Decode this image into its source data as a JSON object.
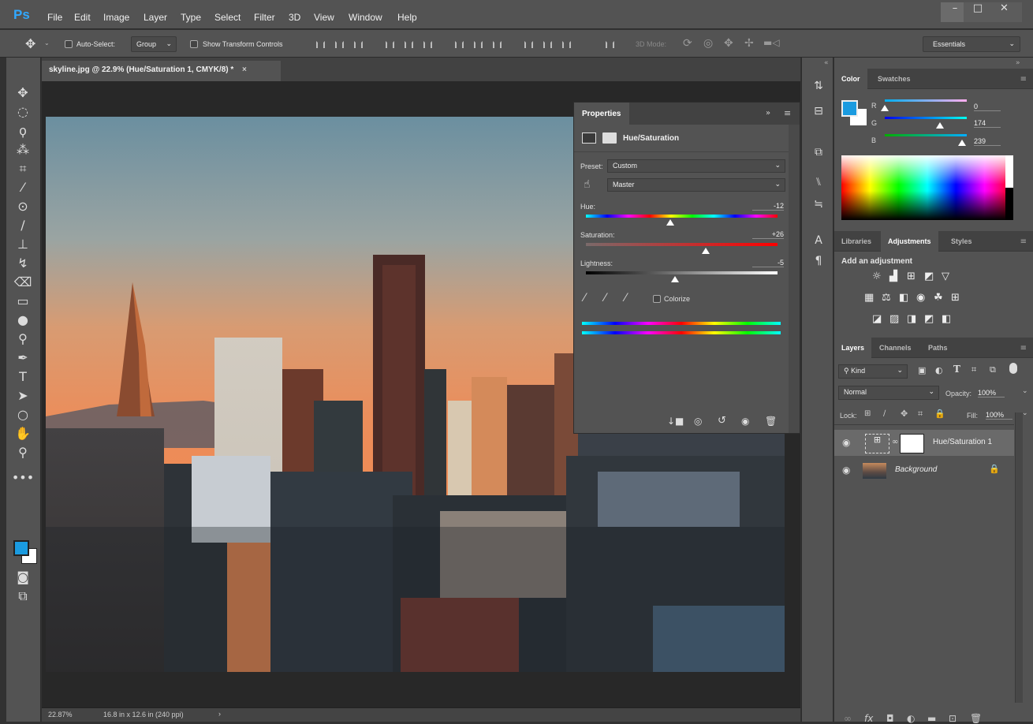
{
  "app": {
    "logo": "Ps",
    "brand_color": "#31a8ff"
  },
  "menu": [
    "File",
    "Edit",
    "Image",
    "Layer",
    "Type",
    "Select",
    "Filter",
    "3D",
    "View",
    "Window",
    "Help"
  ],
  "window_controls": {
    "minimize": "–",
    "maximize": "□",
    "close": "✕"
  },
  "options": {
    "auto_select_label": "Auto-Select:",
    "auto_select_checked": false,
    "auto_select_mode": "Group",
    "show_transform_label": "Show Transform Controls",
    "show_transform_checked": false,
    "mode3d_label": "3D Mode:",
    "workspace": "Essentials"
  },
  "document": {
    "tab_title": "skyline.jpg @ 22.9% (Hue/Saturation 1, CMYK/8) *",
    "tab_close": "×"
  },
  "status": {
    "zoom": "22.87%",
    "doc_size": "16.8 in x 12.6 in (240 ppi)",
    "arrow": "›"
  },
  "tools": [
    "move-tool",
    "marquee-tool",
    "lasso-tool",
    "magic-wand-tool",
    "crop-tool",
    "eyedropper-tool",
    "spot-healing-tool",
    "brush-tool",
    "clone-stamp-tool",
    "history-brush-tool",
    "eraser-tool",
    "gradient-tool",
    "blur-tool",
    "dodge-tool",
    "pen-tool",
    "type-tool",
    "path-selection-tool",
    "ellipse-tool",
    "hand-tool",
    "zoom-tool",
    "edit-toolbar"
  ],
  "tool_glyphs": [
    "✥",
    "◌",
    "ϙ",
    "⁂",
    "⌗",
    "⁄",
    "⊙",
    "∕",
    "⊥",
    "↯",
    "⌫",
    "▭",
    "●",
    "⚲",
    "✒",
    "T",
    "➤",
    "○",
    "✋",
    "⚲",
    "•••"
  ],
  "colors": {
    "foreground": "#1a9be0",
    "background": "#ffffff"
  },
  "properties": {
    "tab": "Properties",
    "title": "Hue/Saturation",
    "preset_label": "Preset:",
    "preset": "Custom",
    "range": "Master",
    "hue_label": "Hue:",
    "hue": "-12",
    "saturation_label": "Saturation:",
    "saturation": "+26",
    "lightness_label": "Lightness:",
    "lightness": "-5",
    "colorize_label": "Colorize",
    "colorize_checked": false
  },
  "color_panel": {
    "tabs": [
      "Color",
      "Swatches"
    ],
    "r_label": "R",
    "r": "0",
    "g_label": "G",
    "g": "174",
    "b_label": "B",
    "b": "239"
  },
  "adjustments_panel": {
    "tabs": [
      "Libraries",
      "Adjustments",
      "Styles"
    ],
    "heading": "Add an adjustment",
    "row1": [
      "brightness-contrast-icon",
      "levels-icon",
      "curves-icon",
      "exposure-icon",
      "gradient-triangle-icon"
    ],
    "row1_glyphs": [
      "☼",
      "▟",
      "⊞",
      "◩",
      "▽"
    ],
    "row2": [
      "vibrance-icon",
      "color-balance-icon",
      "black-white-icon",
      "photo-filter-icon",
      "channel-mixer-icon",
      "color-lookup-icon"
    ],
    "row2_glyphs": [
      "▦",
      "⚖",
      "◧",
      "◉",
      "☘",
      "⊞"
    ],
    "row3": [
      "invert-icon",
      "posterize-icon",
      "threshold-icon",
      "selective-color-icon",
      "gradient-map-icon"
    ],
    "row3_glyphs": [
      "◪",
      "▨",
      "◨",
      "◩",
      "◧"
    ]
  },
  "layers_panel": {
    "tabs": [
      "Layers",
      "Channels",
      "Paths"
    ],
    "filter": "Kind",
    "blend_mode": "Normal",
    "opacity_label": "Opacity:",
    "opacity": "100%",
    "lock_label": "Lock:",
    "fill_label": "Fill:",
    "fill": "100%",
    "layers": [
      {
        "name": "Hue/Saturation 1",
        "visible": true,
        "selected": true
      },
      {
        "name": "Background",
        "visible": true,
        "locked": true
      }
    ]
  }
}
